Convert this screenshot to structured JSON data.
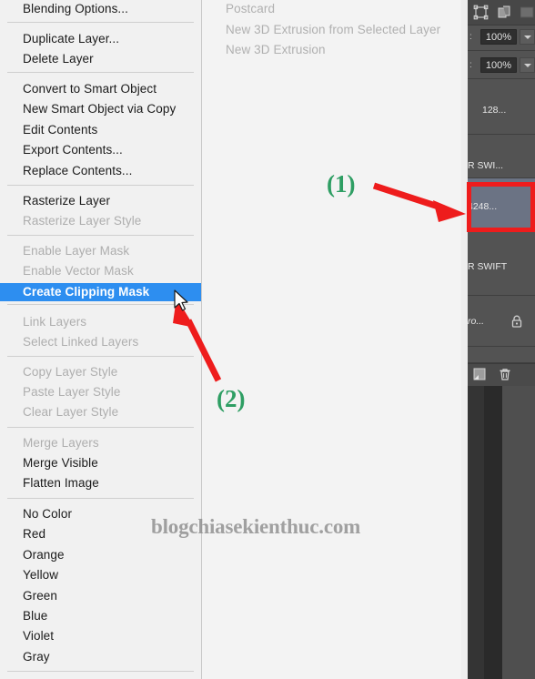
{
  "app": {
    "watermark": "blogchiasekienthuc.com"
  },
  "context_menu": {
    "groups": [
      {
        "items": [
          {
            "label": "Blending Options...",
            "state": "normal"
          }
        ]
      },
      {
        "items": [
          {
            "label": "Duplicate Layer...",
            "state": "normal"
          },
          {
            "label": "Delete Layer",
            "state": "normal"
          }
        ]
      },
      {
        "items": [
          {
            "label": "Convert to Smart Object",
            "state": "normal"
          },
          {
            "label": "New Smart Object via Copy",
            "state": "normal"
          },
          {
            "label": "Edit Contents",
            "state": "normal"
          },
          {
            "label": "Export Contents...",
            "state": "normal"
          },
          {
            "label": "Replace Contents...",
            "state": "normal"
          }
        ]
      },
      {
        "items": [
          {
            "label": "Rasterize Layer",
            "state": "normal"
          },
          {
            "label": "Rasterize Layer Style",
            "state": "disabled"
          }
        ]
      },
      {
        "items": [
          {
            "label": "Enable Layer Mask",
            "state": "disabled"
          },
          {
            "label": "Enable Vector Mask",
            "state": "disabled"
          },
          {
            "label": "Create Clipping Mask",
            "state": "highlight"
          }
        ]
      },
      {
        "items": [
          {
            "label": "Link Layers",
            "state": "disabled"
          },
          {
            "label": "Select Linked Layers",
            "state": "disabled"
          }
        ]
      },
      {
        "items": [
          {
            "label": "Copy Layer Style",
            "state": "disabled"
          },
          {
            "label": "Paste Layer Style",
            "state": "disabled"
          },
          {
            "label": "Clear Layer Style",
            "state": "disabled"
          }
        ]
      },
      {
        "items": [
          {
            "label": "Merge Layers",
            "state": "disabled"
          },
          {
            "label": "Merge Visible",
            "state": "normal"
          },
          {
            "label": "Flatten Image",
            "state": "normal"
          }
        ]
      },
      {
        "items": [
          {
            "label": "No Color",
            "state": "normal"
          },
          {
            "label": "Red",
            "state": "normal"
          },
          {
            "label": "Orange",
            "state": "normal"
          },
          {
            "label": "Yellow",
            "state": "normal"
          },
          {
            "label": "Green",
            "state": "normal"
          },
          {
            "label": "Blue",
            "state": "normal"
          },
          {
            "label": "Violet",
            "state": "normal"
          },
          {
            "label": "Gray",
            "state": "normal"
          }
        ]
      }
    ]
  },
  "submenu_3d": {
    "items": [
      {
        "label": "Postcard",
        "state": "disabled"
      },
      {
        "label": "New 3D Extrusion from Selected Layer",
        "state": "disabled"
      },
      {
        "label": "New 3D Extrusion",
        "state": "disabled"
      }
    ]
  },
  "layers_panel": {
    "toolbar_icons": [
      {
        "name": "transform-box-icon"
      },
      {
        "name": "duplicate-layers-icon"
      },
      {
        "name": "panel-menu-icon"
      }
    ],
    "properties": [
      {
        "label": ":",
        "value": "100%",
        "name": "opacity"
      },
      {
        "label": ":",
        "value": "100%",
        "name": "fill"
      }
    ],
    "layers": [
      {
        "name_text": "128...",
        "selected": false,
        "locked": false
      },
      {
        "name_text": "R SWI...",
        "selected": false,
        "locked": false
      },
      {
        "name_text": "4248...",
        "selected": true,
        "locked": false
      },
      {
        "name_text": "R SWIFT",
        "selected": false,
        "locked": false
      },
      {
        "name_text": "ro...",
        "selected": false,
        "locked": true
      }
    ],
    "bottom_icons": [
      {
        "name": "new-layer-icon"
      },
      {
        "name": "delete-layer-icon"
      }
    ]
  },
  "annotations": [
    {
      "id": "step-1",
      "label": "(1)",
      "color": "#2e9e63"
    },
    {
      "id": "step-2",
      "label": "(2)",
      "color": "#2e9e63"
    }
  ],
  "colors": {
    "highlight": "#2d8ef0",
    "annotation_red": "#ee1c1c",
    "annotation_green": "#2e9e63",
    "panel_bg": "#535353"
  }
}
